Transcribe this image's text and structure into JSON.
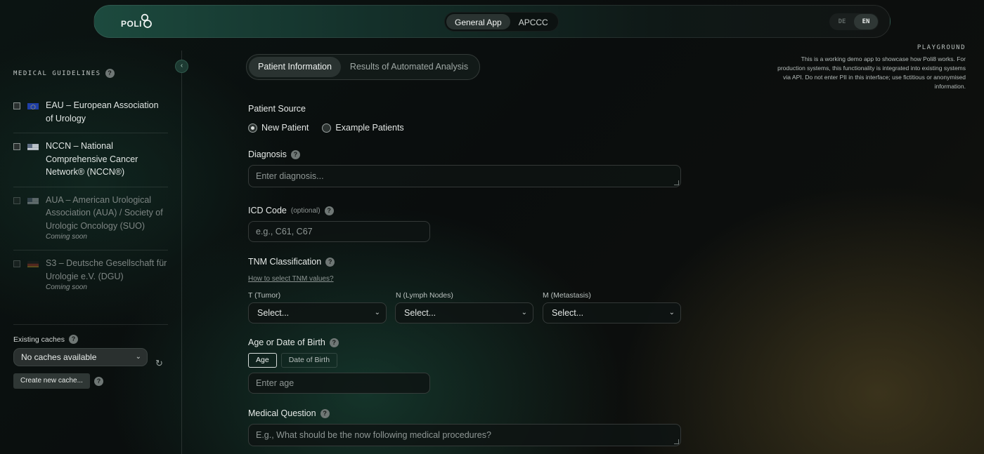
{
  "header": {
    "logo_text": "POLI",
    "app_tabs": [
      "General App",
      "APCCC"
    ],
    "active_app_tab": 0,
    "languages": [
      "DE",
      "EN"
    ],
    "active_language": 1
  },
  "playground": {
    "title": "PLAYGROUND",
    "text": "This is a working demo app to showcase how Poli8 works. For production systems, this functionality is integrated into existing systems via API. Do not enter PII in this interface; use fictitious or anonymised information."
  },
  "sidebar": {
    "collapse_icon": "chevron-left-icon",
    "guidelines_title": "MEDICAL GUIDELINES",
    "guidelines": [
      {
        "label": "EAU – European Association of Urology",
        "flag": "eu",
        "checked": false,
        "disabled": false,
        "note": ""
      },
      {
        "label": "NCCN – National Comprehensive Cancer Network® (NCCN®)",
        "flag": "us",
        "checked": false,
        "disabled": false,
        "note": ""
      },
      {
        "label": "AUA – American Urological Association (AUA) / Society of Urologic Oncology (SUO)",
        "flag": "us",
        "checked": false,
        "disabled": true,
        "note": "Coming soon"
      },
      {
        "label": "S3 – Deutsche Gesellschaft für Urologie e.V. (DGU)",
        "flag": "de",
        "checked": false,
        "disabled": true,
        "note": "Coming soon"
      }
    ],
    "caches_label": "Existing caches",
    "caches_selected": "No caches available",
    "create_cache_label": "Create new cache..."
  },
  "tabs": [
    "Patient Information",
    "Results of Automated Analysis"
  ],
  "active_tab": 0,
  "form": {
    "patient_source_label": "Patient Source",
    "patient_source_options": [
      "New Patient",
      "Example Patients"
    ],
    "patient_source_selected": 0,
    "diagnosis_label": "Diagnosis",
    "diagnosis_placeholder": "Enter diagnosis...",
    "icd_label": "ICD Code",
    "icd_optional": "(optional)",
    "icd_placeholder": "e.g., C61, C67",
    "tnm_label": "TNM Classification",
    "tnm_help_link": "How to select TNM values?",
    "tnm_fields": [
      {
        "label": "T (Tumor)",
        "value": "Select..."
      },
      {
        "label": "N (Lymph Nodes)",
        "value": "Select..."
      },
      {
        "label": "M (Metastasis)",
        "value": "Select..."
      }
    ],
    "age_label": "Age or Date of Birth",
    "age_modes": [
      "Age",
      "Date of Birth"
    ],
    "age_mode_selected": 0,
    "age_placeholder": "Enter age",
    "question_label": "Medical Question",
    "question_placeholder": "E.g., What should be the now following medical procedures?"
  },
  "colors": {
    "accent": "#1c4a3e",
    "background": "#0b1110"
  }
}
